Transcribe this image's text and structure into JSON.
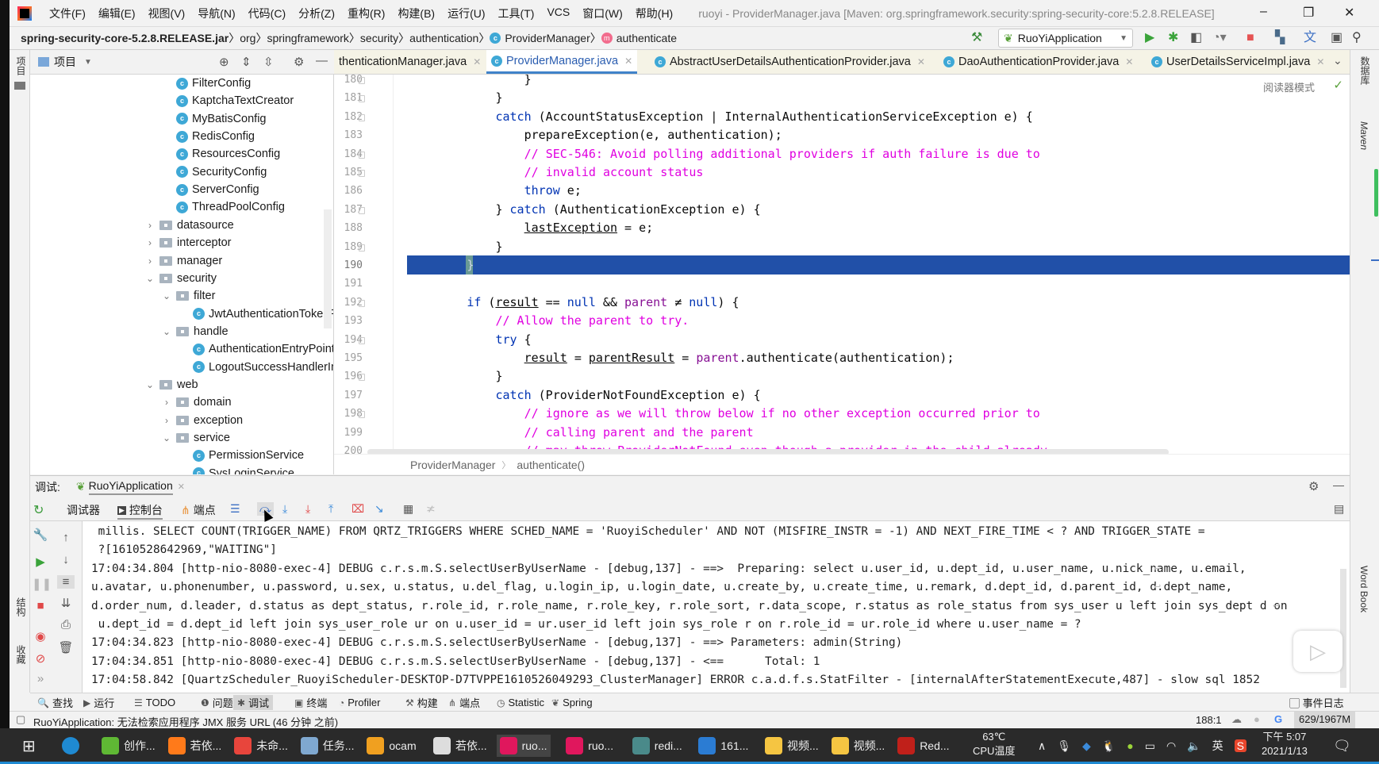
{
  "window": {
    "title": "ruoyi - ProviderManager.java [Maven: org.springframework.security:spring-security-core:5.2.8.RELEASE]",
    "menu": [
      "文件(F)",
      "编辑(E)",
      "视图(V)",
      "导航(N)",
      "代码(C)",
      "分析(Z)",
      "重构(R)",
      "构建(B)",
      "运行(U)",
      "工具(T)",
      "VCS",
      "窗口(W)",
      "帮助(H)"
    ],
    "minimize": "–",
    "restore": "❐",
    "close": "✕"
  },
  "navbar": {
    "crumbs": [
      "spring-security-core-5.2.8.RELEASE.jar",
      "org",
      "springframework",
      "security",
      "authentication",
      "ProviderManager",
      "authenticate"
    ],
    "run_config": "RuoYiApplication"
  },
  "left_strip": {
    "project": "项目",
    "structure": "结构",
    "favorites": "收藏"
  },
  "right_strip": {
    "database": "数据库",
    "maven": "Maven",
    "wordbook": "Word Book"
  },
  "project": {
    "title": "项目",
    "tree": [
      {
        "label": "FilterConfig",
        "depth": 2,
        "type": "class"
      },
      {
        "label": "KaptchaTextCreator",
        "depth": 2,
        "type": "class"
      },
      {
        "label": "MyBatisConfig",
        "depth": 2,
        "type": "class"
      },
      {
        "label": "RedisConfig",
        "depth": 2,
        "type": "class"
      },
      {
        "label": "ResourcesConfig",
        "depth": 2,
        "type": "class"
      },
      {
        "label": "SecurityConfig",
        "depth": 2,
        "type": "class"
      },
      {
        "label": "ServerConfig",
        "depth": 2,
        "type": "class"
      },
      {
        "label": "ThreadPoolConfig",
        "depth": 2,
        "type": "class"
      },
      {
        "label": "datasource",
        "depth": 1,
        "type": "folder",
        "expanded": false
      },
      {
        "label": "interceptor",
        "depth": 1,
        "type": "folder",
        "expanded": false
      },
      {
        "label": "manager",
        "depth": 1,
        "type": "folder",
        "expanded": false
      },
      {
        "label": "security",
        "depth": 1,
        "type": "folder",
        "expanded": true
      },
      {
        "label": "filter",
        "depth": 2,
        "type": "folder",
        "expanded": true
      },
      {
        "label": "JwtAuthenticationTokenFilt",
        "depth": 3,
        "type": "class"
      },
      {
        "label": "handle",
        "depth": 2,
        "type": "folder",
        "expanded": true
      },
      {
        "label": "AuthenticationEntryPointIm",
        "depth": 3,
        "type": "class"
      },
      {
        "label": "LogoutSuccessHandlerImp",
        "depth": 3,
        "type": "class"
      },
      {
        "label": "web",
        "depth": 1,
        "type": "folder",
        "expanded": true
      },
      {
        "label": "domain",
        "depth": 2,
        "type": "folder",
        "expanded": false
      },
      {
        "label": "exception",
        "depth": 2,
        "type": "folder",
        "expanded": false
      },
      {
        "label": "service",
        "depth": 2,
        "type": "folder",
        "expanded": true
      },
      {
        "label": "PermissionService",
        "depth": 3,
        "type": "class"
      },
      {
        "label": "SysLoginService",
        "depth": 3,
        "type": "class"
      }
    ]
  },
  "tabs": [
    {
      "label": "thenticationManager.java",
      "active": false
    },
    {
      "label": "ProviderManager.java",
      "active": true
    },
    {
      "label": "AbstractUserDetailsAuthenticationProvider.java",
      "active": false
    },
    {
      "label": "DaoAuthenticationProvider.java",
      "active": false
    },
    {
      "label": "UserDetailsServiceImpl.java",
      "active": false
    }
  ],
  "editor": {
    "reader_mode": "阅读器模式",
    "highlighted_line": 190,
    "lines": [
      {
        "n": "180",
        "i": 16,
        "t": [
          [
            "}",
            ""
          ]
        ]
      },
      {
        "n": "181",
        "i": 12,
        "t": [
          [
            "}",
            ""
          ]
        ]
      },
      {
        "n": "182",
        "i": 12,
        "t": [
          [
            "catch",
            "kw"
          ],
          [
            " (AccountStatusException | InternalAuthenticationServiceException e) {",
            ""
          ]
        ]
      },
      {
        "n": "183",
        "i": 16,
        "t": [
          [
            "prepareException(e, authentication);",
            ""
          ]
        ]
      },
      {
        "n": "184",
        "i": 16,
        "t": [
          [
            "// SEC-546: Avoid polling additional providers if auth failure is due to",
            "cm"
          ]
        ]
      },
      {
        "n": "185",
        "i": 16,
        "t": [
          [
            "// invalid account status",
            "cm"
          ]
        ]
      },
      {
        "n": "186",
        "i": 16,
        "t": [
          [
            "throw",
            "kw"
          ],
          [
            " e;",
            ""
          ]
        ]
      },
      {
        "n": "187",
        "i": 12,
        "t": [
          [
            "} ",
            ""
          ],
          [
            "catch",
            "kw"
          ],
          [
            " (AuthenticationException e) {",
            ""
          ]
        ]
      },
      {
        "n": "188",
        "i": 16,
        "t": [
          [
            "lastException",
            "ul"
          ],
          [
            " = e;",
            ""
          ]
        ]
      },
      {
        "n": "189",
        "i": 12,
        "t": [
          [
            "}",
            ""
          ]
        ]
      },
      {
        "n": "190",
        "i": 8,
        "t": [
          [
            "}",
            ""
          ]
        ]
      },
      {
        "n": "191",
        "i": 0,
        "t": []
      },
      {
        "n": "192",
        "i": 8,
        "t": [
          [
            "if",
            "kw"
          ],
          [
            " (",
            ""
          ],
          [
            "result",
            "ul"
          ],
          [
            " == ",
            ""
          ],
          [
            "null",
            "kw"
          ],
          [
            " && ",
            ""
          ],
          [
            "parent",
            "fld"
          ],
          [
            " ≠ ",
            ""
          ],
          [
            "null",
            "kw"
          ],
          [
            ") {",
            ""
          ]
        ]
      },
      {
        "n": "193",
        "i": 12,
        "t": [
          [
            "// Allow the parent to try.",
            "cm"
          ]
        ]
      },
      {
        "n": "194",
        "i": 12,
        "t": [
          [
            "try",
            "kw"
          ],
          [
            " {",
            ""
          ]
        ]
      },
      {
        "n": "195",
        "i": 16,
        "t": [
          [
            "result",
            "ul"
          ],
          [
            " = ",
            ""
          ],
          [
            "parentResult",
            "ul"
          ],
          [
            " = ",
            ""
          ],
          [
            "parent",
            "fld"
          ],
          [
            ".authenticate(authentication);",
            ""
          ]
        ]
      },
      {
        "n": "196",
        "i": 12,
        "t": [
          [
            "}",
            ""
          ]
        ]
      },
      {
        "n": "197",
        "i": 12,
        "t": [
          [
            "catch",
            "kw"
          ],
          [
            " (ProviderNotFoundException e) {",
            ""
          ]
        ]
      },
      {
        "n": "198",
        "i": 16,
        "t": [
          [
            "// ignore as we will throw below if no other exception occurred prior to",
            "cm"
          ]
        ]
      },
      {
        "n": "199",
        "i": 16,
        "t": [
          [
            "// calling parent and the parent",
            "cm"
          ]
        ]
      },
      {
        "n": "200",
        "i": 16,
        "t": [
          [
            "// may throw ProviderNotFound even though a provider in the child already",
            "cm"
          ]
        ]
      }
    ],
    "breadcrumb": [
      "ProviderManager",
      "authenticate()"
    ]
  },
  "debug": {
    "label": "调试:",
    "session": "RuoYiApplication",
    "tabs": [
      "调试器",
      "控制台",
      "端点"
    ],
    "console": [
      " millis. SELECT COUNT(TRIGGER_NAME) FROM QRTZ_TRIGGERS WHERE SCHED_NAME = 'RuoyiScheduler' AND NOT (MISFIRE_INSTR = -1) AND NEXT_FIRE_TIME < ? AND TRIGGER_STATE =",
      " ?[1610528642969,\"WAITING\"]",
      "17:04:34.804 [http-nio-8080-exec-4] DEBUG c.r.s.m.S.selectUserByUserName - [debug,137] - ==>  Preparing: select u.user_id, u.dept_id, u.user_name, u.nick_name, u.email,",
      "u.avatar, u.phonenumber, u.password, u.sex, u.status, u.del_flag, u.login_ip, u.login_date, u.create_by, u.create_time, u.remark, d.dept_id, d.parent_id, d.dept_name,",
      "d.order_num, d.leader, d.status as dept_status, r.role_id, r.role_name, r.role_key, r.role_sort, r.data_scope, r.status as role_status from sys_user u left join sys_dept d on",
      " u.dept_id = d.dept_id left join sys_user_role ur on u.user_id = ur.user_id left join sys_role r on r.role_id = ur.role_id where u.user_name = ?",
      "17:04:34.823 [http-nio-8080-exec-4] DEBUG c.r.s.m.S.selectUserByUserName - [debug,137] - ==> Parameters: admin(String)",
      "17:04:34.851 [http-nio-8080-exec-4] DEBUG c.r.s.m.S.selectUserByUserName - [debug,137] - <==      Total: 1",
      "17:04:58.842 [QuartzScheduler_RuoyiScheduler-DESKTOP-D7TVPPE1610526049293_ClusterManager] ERROR c.a.d.f.s.StatFilter - [internalAfterStatementExecute,487] - slow sql 1852"
    ]
  },
  "bottom_tools": [
    {
      "label": "查找",
      "icon": "🔍"
    },
    {
      "label": "运行",
      "icon": "▶"
    },
    {
      "label": "TODO",
      "icon": "☰"
    },
    {
      "label": "问题",
      "icon": "❶"
    },
    {
      "label": "调试",
      "icon": "✱",
      "active": true
    },
    {
      "label": "终端",
      "icon": "▣"
    },
    {
      "label": "Profiler",
      "icon": "◔"
    },
    {
      "label": "构建",
      "icon": "⚒"
    },
    {
      "label": "端点",
      "icon": "⋔"
    },
    {
      "label": "Statistic",
      "icon": "◷"
    },
    {
      "label": "Spring",
      "icon": "❦"
    }
  ],
  "event_log": "事件日志",
  "status": {
    "message": "RuoYiApplication: 无法检索应用程序 JMX 服务 URL (46 分钟 之前)",
    "position": "188:1",
    "memory": "629/1967M"
  },
  "taskbar": {
    "items": [
      {
        "label": "创作...",
        "color": "#5fb834"
      },
      {
        "label": "若依...",
        "color": "#ff7a1a"
      },
      {
        "label": "未命...",
        "color": "#e8453c"
      },
      {
        "label": "任务...",
        "color": "#7fa8d0"
      },
      {
        "label": "ocam",
        "color": "#f0a020"
      },
      {
        "label": "若依...",
        "color": "#dddddd"
      },
      {
        "label": "ruo...",
        "color": "#e0175d",
        "active": true
      },
      {
        "label": "ruo...",
        "color": "#e0175d"
      },
      {
        "label": "redi...",
        "color": "#4a8a8a"
      },
      {
        "label": "161...",
        "color": "#2b7cd3"
      },
      {
        "label": "视频...",
        "color": "#f5c542"
      },
      {
        "label": "视频...",
        "color": "#f5c542"
      },
      {
        "label": "Red...",
        "color": "#c0201a"
      }
    ],
    "cpu_temp": "63℃",
    "cpu_label": "CPU温度",
    "ime": "英",
    "time": "下午 5:07",
    "date": "2021/1/13"
  }
}
